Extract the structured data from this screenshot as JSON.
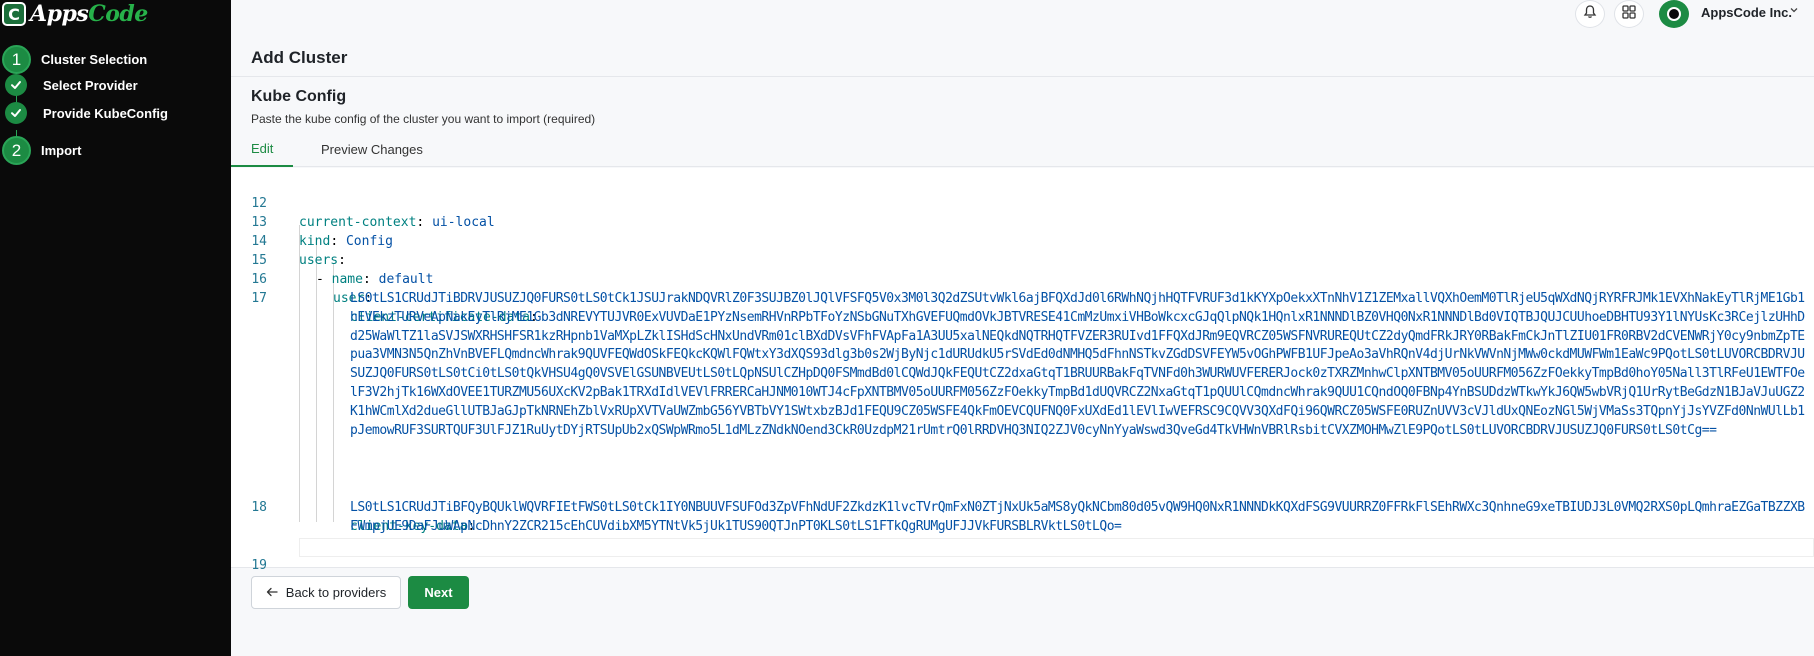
{
  "brand": {
    "mark": "C",
    "name_part1": "Apps",
    "name_part2": "Code",
    "primary_color": "#1c8b43",
    "sidebar_bg": "#0a0a0a"
  },
  "steps": [
    {
      "type": "number",
      "num": "1",
      "label": "Cluster Selection"
    },
    {
      "type": "check",
      "label": "Select Provider"
    },
    {
      "type": "check",
      "label": "Provide KubeConfig"
    },
    {
      "type": "number",
      "num": "2",
      "label": "Import"
    }
  ],
  "topbar": {
    "bell_icon": "bell-icon",
    "apps_icon": "grid-icon",
    "org_name": "AppsCode Inc.",
    "caret": "chevron-down-icon"
  },
  "page": {
    "title": "Add Cluster",
    "section_title": "Kube Config",
    "section_desc": "Paste the kube config of the cluster you want to import (required)"
  },
  "tabs": [
    {
      "label": "Edit",
      "active": true
    },
    {
      "label": "Preview Changes",
      "active": false
    }
  ],
  "editor": {
    "lines": [
      {
        "num": "12",
        "key": "current-context",
        "value": "ui-local"
      },
      {
        "num": "13",
        "key": "kind",
        "value": "Config"
      },
      {
        "num": "14",
        "key": "users",
        "value": ""
      },
      {
        "num": "15",
        "key": "name",
        "value": "default",
        "dash": "- "
      },
      {
        "num": "16",
        "key": "user",
        "value": ""
      },
      {
        "num": "17",
        "key": "client-certificate-data",
        "value": ""
      },
      {
        "num": "18",
        "key": "client-key-data",
        "value": ""
      },
      {
        "num": "19",
        "key": "",
        "value": ""
      }
    ],
    "cert_data": "LS0tLS1CRUdJTiBDRVJUSUZJQ0FURS0tLS0tCk1JSUJrakNDQVRlZ0F3SUJBZ0lJQlVFSFQ5V0x3M0l3Q2dZSUtvWkl6ajBFQXdJd0l6RWhNQjhHQTFVRUF3d1kKYXpOekxXTnNhV1Z1ZEMxallVQXhOemM0TlRjeU5qWXdNQjRYRFRJMk1EVXhNakEyTlRjME1Gb1hEVEkzTURVeApNakEyTlRjME1Gb3dNREVYTUJVR0ExVUVDaE1PYzNsemRHVnRPbTFoYzNSbGNuTXhGVEFUQmdOVkJBTVRESE41CmMzUmxiVHBoWkcxcGJqQlpNQk1HQnlxR1NNNDlBZ0VHQ0NxR1NNNDlBd0VIQTBJQUJCUUhoeDBHTU93Y1lNYUsKc3RCejlzUHhDd25WaWlTZ1laSVJSWXRHSHFSR1kzRHpnb1VaMXpLZklISHdScHNxUndVRm01clBXdDVsVFhFVApFa1A3UU5xalNEQkdNQTRHQTFVZER3RUIvd1FFQXdJRm9EQVRCZ05WSFNVRUREQUtCZ2dyQmdFRkJRY0RBakFmCkJnTlZIU01FR0RBV2dCVENWRjY0cy9nbmZpTEpua3VMN3N5QnZhVnBVEFLQmdncWhrak9QUVFEQWdOSkFEQkcKQWlFQWtxY3dXQS93dlg3b0s2WjByNjc1dURUdkU5rSVdEd0dNMHQ5dFhnNSTkvZGdDSVFEYW5vOGhPWFB1UFJpeAo3aVhRQnV4djUrNkVWVnNjMWw0ckdMUWFWm1EaWc9PQotLS0tLUVORCBDRVJUSUZJQ0FURS0tLS0tCi0tLS0tQkVHSU4gQ0VSVElGSUNBVEUtLS0tLQpNSUlCZHpDQ0FSMmdBd0lCQWdJQkFEQUtCZ2dxaGtqT1BRUURBakFqTVNFd0h3WURWUVFERERJock0zTXRZMnhwClpXNTBMV05oUURFM056ZzFOekkyTmpBd0hoY05Nall3TlRFeU1EWTFOelF3V2hjTk16WXdOVEE1TURZMU56UXcKV2pBak1TRXdIdlVEVlFRRERCaHJNM010WTJ4cFpXNTBMV05oUURFM056ZzFOekkyTmpBd1dUQVRCZ2NxaGtqT1pQUUlCQmdncWhrak9QUU1CQndOQ0FBNp4YnBSUDdzWTkwYkJ6QW5wbVRjQ1UrRytBeGdzN1BJaVJuUGZ2K1hWCmlXd2dueGllUTBJaGJpTkNRNEhZblVxRUpXVTVaUWZmbG56YVBTbVY1SWtxbzBJd1FEQU9CZ05WSFE4QkFmOEVCQUFNQ0FxUXdEd1lEVlIwVEFRSC9CQVV3QXdFQi96QWRCZ05WSFE0RUZnUVV3cVJldUxQNEozNGl5WjVMaSs3TQpnYjJsYVZFd0NnWUlLb1pJemowRUF3SURTQUF3UlFJZ1RuUytDYjRTSUpUb2xQSWpWRmo5L1dMLzZNdkNOend3CkR0UzdpM21rUmtrQ0lRRDVHQ3NIQ2ZJV0cyNnYyaWswd3QveGd4TkVHWnVBRlRsbitCVXZMOHMwZlE9PQotLS0tLUVORCBDRVJUSUZJQ0FURS0tLS0tCg==",
    "key_data": "LS0tLS1CRUdJTiBFQyBQUklWQVRFIEtFWS0tLS0tCk1IY0NBUUVFSUFOd3ZpVFhNdUF2ZkdzK1lvcTVrQmFxN0ZTjNxUk5aMS8yQkNCbm80d05vQW9HQ0NxR1NNNDkKQXdFSG9VUURRZ0FFRkFlSEhRWXc3QnhneG9xeTBIUDJ3L0VMQ2RXS0pLQmhraEZGaTBZZXBFWmpjUE9DaFJuWApNcDhnY2ZCR215cEhCUVdibXM5YTNtVk5jUk1TUS90QTJnPT0KLS0tLS1FTkQgRUMgUFJJVkFURSBLRVktLS0tLQo=",
    "token_color_key": "#008080",
    "token_color_value": "#0451a5",
    "line_number_color": "#237893"
  },
  "footer": {
    "back_label": "Back to providers",
    "back_icon": "arrow-left-icon",
    "next_label": "Next"
  }
}
